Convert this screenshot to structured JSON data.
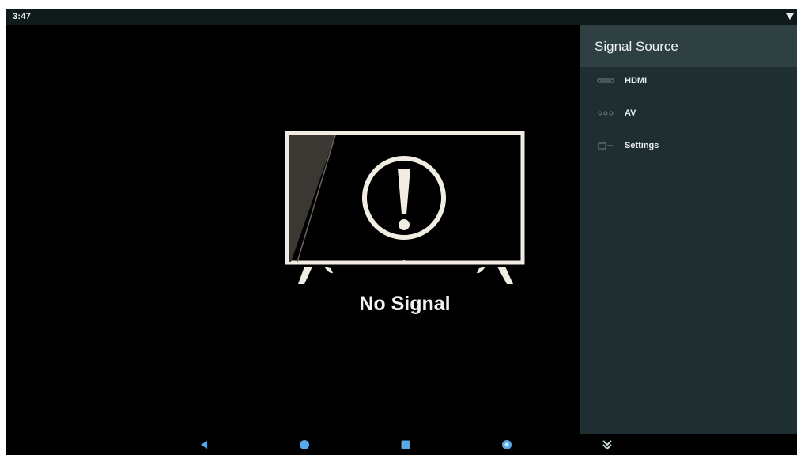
{
  "status_bar": {
    "time": "3:47"
  },
  "main": {
    "message": "No Signal",
    "illustration_icon": "tv-warning-icon"
  },
  "side_panel": {
    "title": "Signal Source",
    "items": [
      {
        "label": "HDMI",
        "icon": "hdmi-icon"
      },
      {
        "label": "AV",
        "icon": "av-icon"
      },
      {
        "label": "Settings",
        "icon": "settings-icon"
      }
    ]
  },
  "nav_bar": {
    "buttons": [
      {
        "icon": "back-icon"
      },
      {
        "icon": "home-icon"
      },
      {
        "icon": "recents-icon"
      },
      {
        "icon": "screenshot-icon"
      },
      {
        "icon": "collapse-icon"
      }
    ]
  },
  "colors": {
    "panel_bg": "#1f2f31",
    "panel_header_bg": "#2f4043",
    "nav_icon": "#5aa8e6",
    "status_bar_bg": "#0f1a1b"
  }
}
